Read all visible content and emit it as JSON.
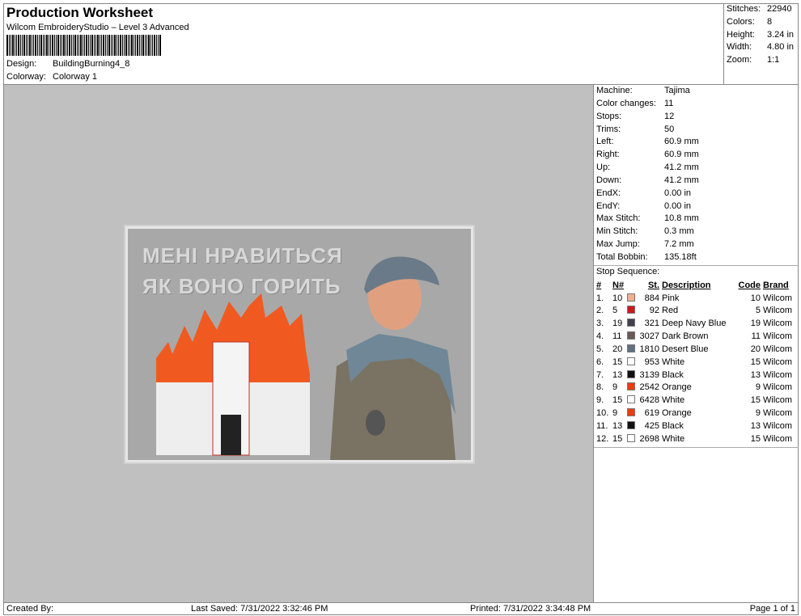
{
  "header": {
    "title": "Production Worksheet",
    "subtitle": "Wilcom EmbroideryStudio – Level 3 Advanced",
    "design_label": "Design:",
    "design_value": "BuildingBurning4_8",
    "colorway_label": "Colorway:",
    "colorway_value": "Colorway 1"
  },
  "summary": [
    {
      "label": "Stitches:",
      "value": "22940"
    },
    {
      "label": "Colors:",
      "value": "8"
    },
    {
      "label": "Height:",
      "value": "3.24 in"
    },
    {
      "label": "Width:",
      "value": "4.80 in"
    },
    {
      "label": "Zoom:",
      "value": "1:1"
    }
  ],
  "machine_stats": [
    {
      "label": "Machine:",
      "value": "Tajima"
    },
    {
      "label": "Color changes:",
      "value": "11"
    },
    {
      "label": "Stops:",
      "value": "12"
    },
    {
      "label": "Trims:",
      "value": "50"
    },
    {
      "label": "Left:",
      "value": "60.9 mm"
    },
    {
      "label": "Right:",
      "value": "60.9 mm"
    },
    {
      "label": "Up:",
      "value": "41.2 mm"
    },
    {
      "label": "Down:",
      "value": "41.2 mm"
    },
    {
      "label": "EndX:",
      "value": "0.00 in"
    },
    {
      "label": "EndY:",
      "value": "0.00 in"
    },
    {
      "label": "Max Stitch:",
      "value": "10.8 mm"
    },
    {
      "label": "Min Stitch:",
      "value": "0.3 mm"
    },
    {
      "label": "Max Jump:",
      "value": "7.2 mm"
    },
    {
      "label": "Total Bobbin:",
      "value": "135.18ft"
    }
  ],
  "stop_sequence": {
    "title": "Stop Sequence:",
    "columns": [
      "#",
      "N#",
      "St.",
      "Description",
      "Code",
      "Brand"
    ],
    "rows": [
      {
        "idx": "1.",
        "n": "10",
        "color": "#f0b090",
        "st": "884",
        "desc": "Pink",
        "code": "10",
        "brand": "Wilcom"
      },
      {
        "idx": "2.",
        "n": "5",
        "color": "#d01820",
        "st": "92",
        "desc": "Red",
        "code": "5",
        "brand": "Wilcom"
      },
      {
        "idx": "3.",
        "n": "19",
        "color": "#404050",
        "st": "321",
        "desc": "Deep Navy Blue",
        "code": "19",
        "brand": "Wilcom"
      },
      {
        "idx": "4.",
        "n": "11",
        "color": "#6a5a58",
        "st": "3027",
        "desc": "Dark Brown",
        "code": "11",
        "brand": "Wilcom"
      },
      {
        "idx": "5.",
        "n": "20",
        "color": "#607080",
        "st": "1810",
        "desc": "Desert Blue",
        "code": "20",
        "brand": "Wilcom"
      },
      {
        "idx": "6.",
        "n": "15",
        "color": "#ffffff",
        "st": "953",
        "desc": "White",
        "code": "15",
        "brand": "Wilcom"
      },
      {
        "idx": "7.",
        "n": "13",
        "color": "#111111",
        "st": "3139",
        "desc": "Black",
        "code": "13",
        "brand": "Wilcom"
      },
      {
        "idx": "8.",
        "n": "9",
        "color": "#f03a10",
        "st": "2542",
        "desc": "Orange",
        "code": "9",
        "brand": "Wilcom"
      },
      {
        "idx": "9.",
        "n": "15",
        "color": "#ffffff",
        "st": "6428",
        "desc": "White",
        "code": "15",
        "brand": "Wilcom"
      },
      {
        "idx": "10.",
        "n": "9",
        "color": "#f03a10",
        "st": "619",
        "desc": "Orange",
        "code": "9",
        "brand": "Wilcom"
      },
      {
        "idx": "11.",
        "n": "13",
        "color": "#111111",
        "st": "425",
        "desc": "Black",
        "code": "13",
        "brand": "Wilcom"
      },
      {
        "idx": "12.",
        "n": "15",
        "color": "#ffffff",
        "st": "2698",
        "desc": "White",
        "code": "15",
        "brand": "Wilcom"
      }
    ]
  },
  "design_preview": {
    "line1": "МЕНІ НРАВИТЬСЯ",
    "line2": "ЯК ВОНО ГОРИТЬ"
  },
  "footer": {
    "created": "Created By:",
    "saved": "Last Saved: 7/31/2022 3:32:46 PM",
    "printed": "Printed: 7/31/2022 3:34:48 PM",
    "page": "Page 1 of 1"
  }
}
